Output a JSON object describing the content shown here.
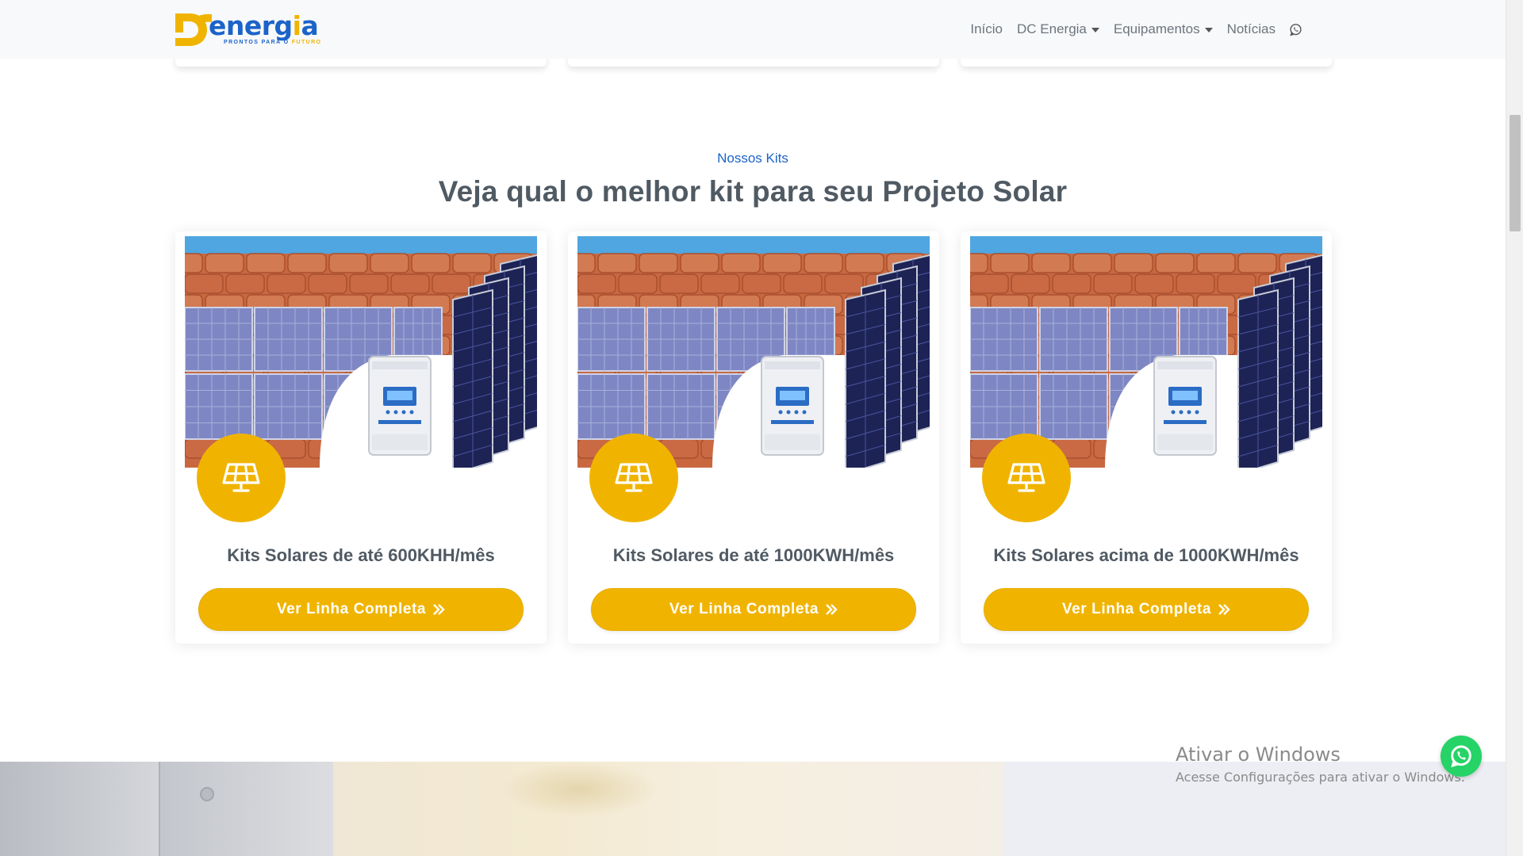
{
  "navbar": {
    "brand": {
      "name_prefix": "energ",
      "name_accent": "i",
      "name_suffix": "a",
      "tagline_a": "PRONTOS PARA O",
      "tagline_b": "FUTURO",
      "mark_icon": "dc-logo-mark-icon"
    },
    "items": [
      {
        "label": "Início",
        "dropdown": false
      },
      {
        "label": "DC Energia",
        "dropdown": true
      },
      {
        "label": "Equipamentos",
        "dropdown": true
      },
      {
        "label": "Notícias",
        "dropdown": false
      }
    ],
    "whatsapp_icon": "whatsapp-icon"
  },
  "section": {
    "eyebrow": "Nossos Kits",
    "title": "Veja qual o melhor kit para seu Projeto Solar"
  },
  "kits": [
    {
      "title": "Kits Solares de até 600KHH/mês",
      "button": "Ver Linha Completa",
      "icon": "solar-panel-icon"
    },
    {
      "title": "Kits Solares de até 1000KWH/mês",
      "button": "Ver Linha Completa",
      "icon": "solar-panel-icon"
    },
    {
      "title": "Kits Solares acima de 1000KWH/mês",
      "button": "Ver Linha Completa",
      "icon": "solar-panel-icon"
    }
  ],
  "watermark": {
    "line1": "Ativar o Windows",
    "line2": "Acesse Configurações para ativar o Windows."
  },
  "colors": {
    "accent": "#f0b400",
    "brand_blue": "#1b63c9",
    "heading": "#505a63",
    "whatsapp": "#25d366"
  }
}
